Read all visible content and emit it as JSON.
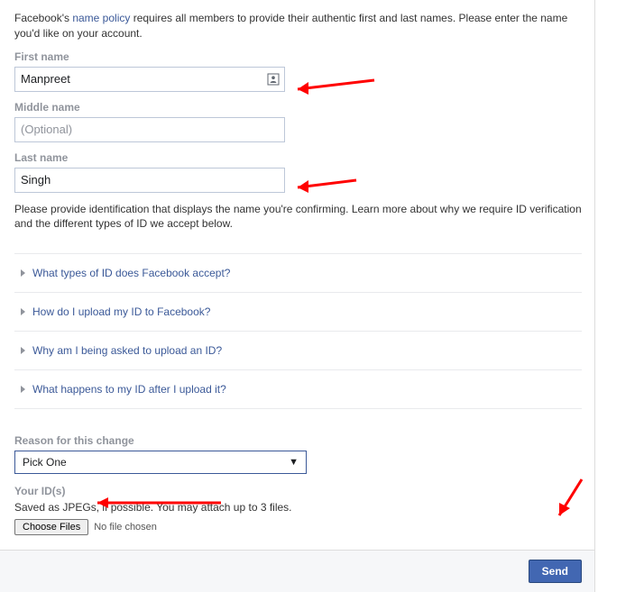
{
  "intro": {
    "pre": "Facebook's ",
    "link": "name policy",
    "post": " requires all members to provide their authentic first and last names. Please enter the name you'd like on your account."
  },
  "fields": {
    "first": {
      "label": "First name",
      "value": "Manpreet"
    },
    "middle": {
      "label": "Middle name",
      "placeholder": "(Optional)"
    },
    "last": {
      "label": "Last name",
      "value": "Singh"
    }
  },
  "verify_text": "Please provide identification that displays the name you're confirming. Learn more about why we require ID verification and the different types of ID we accept below.",
  "faq": [
    "What types of ID does Facebook accept?",
    "How do I upload my ID to Facebook?",
    "Why am I being asked to upload an ID?",
    "What happens to my ID after I upload it?"
  ],
  "reason": {
    "label": "Reason for this change",
    "selected": "Pick One"
  },
  "ids": {
    "label": "Your ID(s)",
    "hint": "Saved as JPEGs, if possible. You may attach up to 3 files.",
    "choose": "Choose Files",
    "nofile": "No file chosen"
  },
  "footer": {
    "send": "Send"
  }
}
